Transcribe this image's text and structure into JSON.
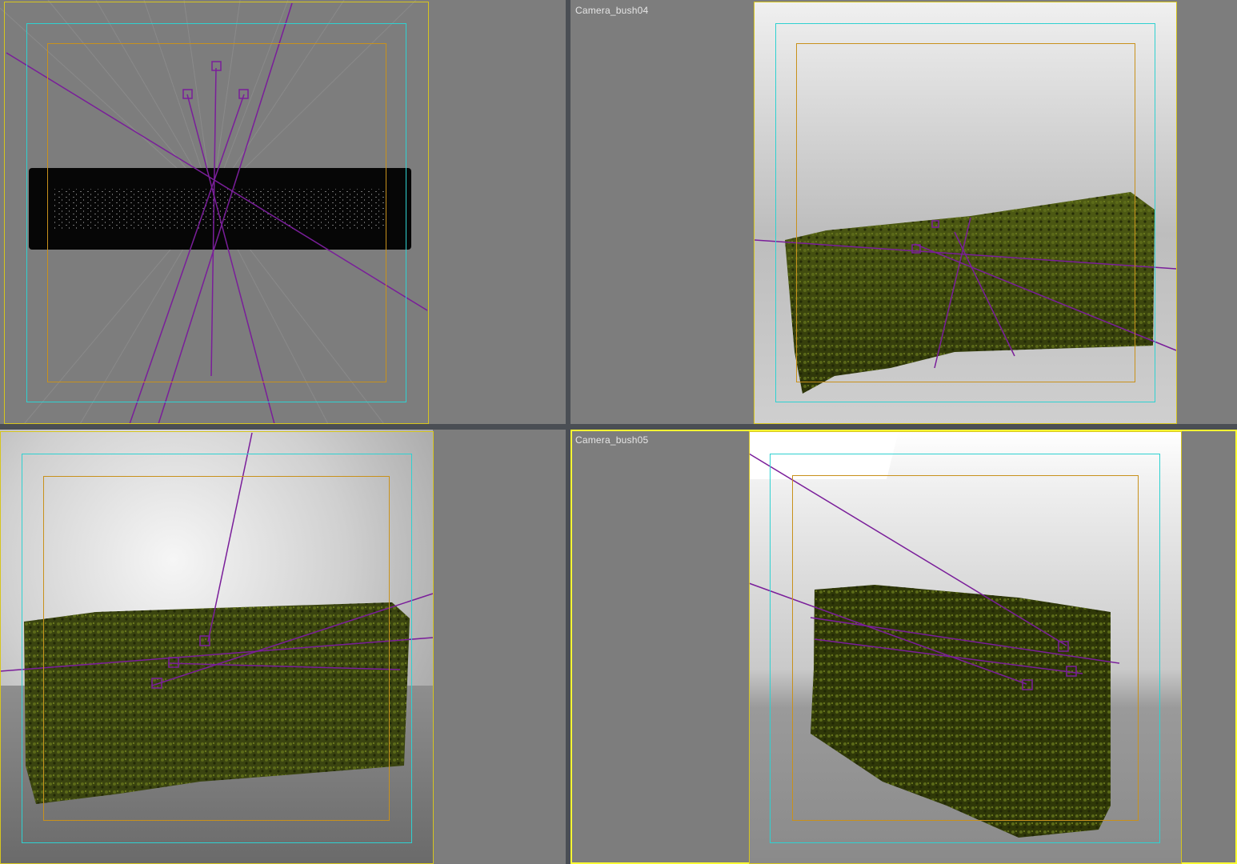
{
  "viewports": {
    "top_left": {
      "label": ""
    },
    "top_right": {
      "label": "Camera_bush04"
    },
    "bottom_left": {
      "label": ""
    },
    "bottom_right": {
      "label": "Camera_bush05",
      "active": true
    }
  },
  "colors": {
    "viewport_bg": "#7d7d7d",
    "frame_outer": "#d6c51e",
    "frame_safe_action": "#2fd1d1",
    "frame_safe_title": "#c8911c",
    "camera_lines": "#7a1e9a",
    "hedge_dark": "#2a3208",
    "hedge_light": "#4d5a12",
    "active_border": "#ffff33"
  }
}
